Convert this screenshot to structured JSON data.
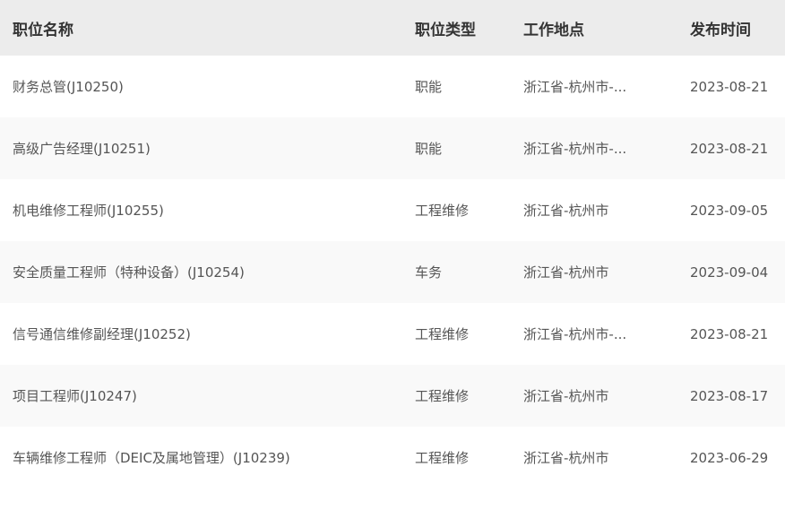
{
  "table": {
    "headers": {
      "title": "职位名称",
      "type": "职位类型",
      "location": "工作地点",
      "date": "发布时间"
    },
    "rows": [
      {
        "title": "财务总管(J10250)",
        "type": "职能",
        "location": "浙江省-杭州市-...",
        "date": "2023-08-21"
      },
      {
        "title": "高级广告经理(J10251)",
        "type": "职能",
        "location": "浙江省-杭州市-...",
        "date": "2023-08-21"
      },
      {
        "title": "机电维修工程师(J10255)",
        "type": "工程维修",
        "location": "浙江省-杭州市",
        "date": "2023-09-05"
      },
      {
        "title": "安全质量工程师（特种设备）(J10254)",
        "type": "车务",
        "location": "浙江省-杭州市",
        "date": "2023-09-04"
      },
      {
        "title": "信号通信维修副经理(J10252)",
        "type": "工程维修",
        "location": "浙江省-杭州市-...",
        "date": "2023-08-21"
      },
      {
        "title": "项目工程师(J10247)",
        "type": "工程维修",
        "location": "浙江省-杭州市",
        "date": "2023-08-17"
      },
      {
        "title": "车辆维修工程师（DEIC及属地管理）(J10239)",
        "type": "工程维修",
        "location": "浙江省-杭州市",
        "date": "2023-06-29"
      }
    ]
  }
}
